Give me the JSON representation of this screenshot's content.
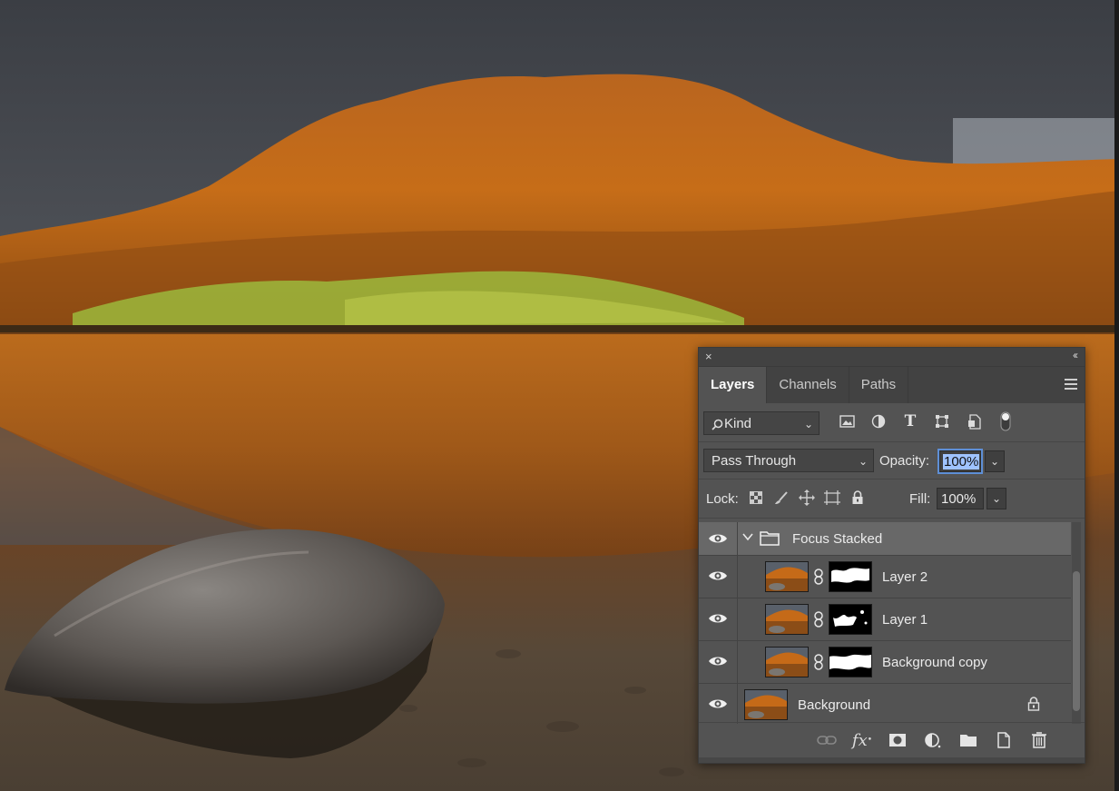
{
  "panel": {
    "close_glyph": "×",
    "collapse_glyph": "‹‹",
    "tabs": [
      {
        "label": "Layers",
        "active": true
      },
      {
        "label": "Channels",
        "active": false
      },
      {
        "label": "Paths",
        "active": false
      }
    ],
    "filter": {
      "kind_label": "Kind",
      "icons": [
        "image-filter-icon",
        "adjustment-filter-icon",
        "type-filter-icon",
        "shape-filter-icon",
        "smart-object-filter-icon",
        "filter-toggle-icon"
      ]
    },
    "blend": {
      "mode": "Pass Through",
      "opacity_label": "Opacity:",
      "opacity_value": "100%"
    },
    "lock": {
      "label": "Lock:",
      "icons": [
        "lock-transparent-pixels-icon",
        "lock-image-pixels-icon",
        "lock-position-icon",
        "lock-artboard-icon",
        "lock-all-icon"
      ],
      "fill_label": "Fill:",
      "fill_value": "100%"
    },
    "layers": [
      {
        "name": "Focus Stacked",
        "type": "group",
        "visible": true,
        "expanded": true
      },
      {
        "name": "Layer 2",
        "type": "layer",
        "visible": true,
        "has_mask": true
      },
      {
        "name": "Layer 1",
        "type": "layer",
        "visible": true,
        "has_mask": true
      },
      {
        "name": "Background copy",
        "type": "layer",
        "visible": true,
        "has_mask": true
      },
      {
        "name": "Background",
        "type": "layer",
        "visible": true,
        "locked": true
      }
    ],
    "footer_icons": [
      "link-layers-icon",
      "fx-icon",
      "add-mask-icon",
      "adjustment-layer-icon",
      "new-group-icon",
      "new-layer-icon",
      "trash-icon"
    ],
    "colors": {
      "panel_bg": "#535353",
      "tab_bar_bg": "#424242",
      "selected_group_bg": "#686868",
      "focus_accent": "#5e8fd6"
    }
  }
}
